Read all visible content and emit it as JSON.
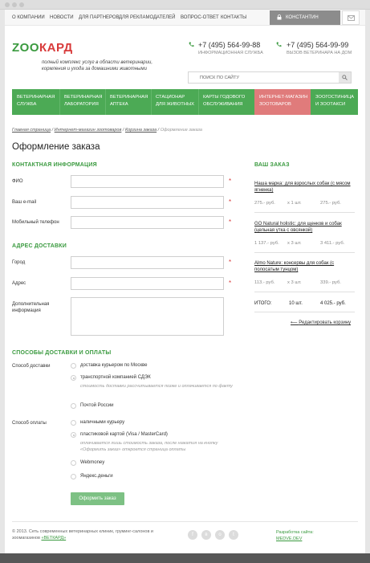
{
  "topnav": {
    "links": [
      "О КОМПАНИИ",
      "НОВОСТИ",
      "ДЛЯ ПАРТНЕРОВ",
      "ДЛЯ РЕКЛАМОДАТЕЛЕЙ",
      "ВОПРОС-ОТВЕТ",
      "КОНТАКТЫ"
    ],
    "user": "КОНСТАНТИН"
  },
  "header": {
    "logo_part1": "ZOO",
    "logo_part2": "КАРД",
    "tagline": "полный комплекс услуг в области ветеринарии, кормления и ухода за домашними животными",
    "phone1": "+7 (495) 564-99-88",
    "phone1_sub": "ИНФОРМАЦИОННАЯ СЛУЖБА",
    "phone2": "+7 (495) 564-99-99",
    "phone2_sub": "ВЫЗОВ ВЕТЕРИНАРА НА ДОМ",
    "search_placeholder": "ПОИСК ПО САЙТУ"
  },
  "menu": [
    {
      "l1": "ВЕТЕРИНАРНАЯ",
      "l2": "СЛУЖБА"
    },
    {
      "l1": "ВЕТЕРИНАРНАЯ",
      "l2": "ЛАБОРАТОРИЯ"
    },
    {
      "l1": "ВЕТЕРИНАРНАЯ",
      "l2": "АПТЕКА"
    },
    {
      "l1": "СТАЦИОНАР",
      "l2": "ДЛЯ ЖИВОТНЫХ"
    },
    {
      "l1": "КАРТЫ ГОДОВОГО",
      "l2": "ОБСЛУЖИВАНИЯ"
    },
    {
      "l1": "ИНТЕРНЕТ-МАГАЗИН",
      "l2": "ЗООТОВАРОВ"
    },
    {
      "l1": "ЗООГОСТИНИЦА",
      "l2": "И ЗООТАКСИ"
    }
  ],
  "breadcrumb": [
    "Главная страница",
    "Интернет-магазин зоотоваров",
    "Корзина заказа",
    "Оформление заказа"
  ],
  "page_title": "Оформление заказа",
  "contact": {
    "heading": "КОНТАКТНАЯ ИНФОРМАЦИЯ",
    "fio": "ФИО",
    "email": "Ваш e-mail",
    "phone": "Мобильный телефон",
    "required_mark": "*"
  },
  "address": {
    "heading": "АДРЕС ДОСТАВКИ",
    "city": "Город",
    "addr": "Адрес",
    "extra": "Дополнительная информация"
  },
  "order": {
    "heading": "ВАШ ЗАКАЗ",
    "items": [
      {
        "name": "Наша марка: для взрослых собак (с мясом ягненка)",
        "price": "275.- руб.",
        "qty": "х 1 шт.",
        "sum": "275.- руб."
      },
      {
        "name": "GO Natural holistic: для щенков и собак (цельная утка с овсянкой)",
        "price": "1 137.- руб.",
        "qty": "х 3 шт.",
        "sum": "3 411.- руб."
      },
      {
        "name": "Almo Nature: консервы для собак (с полосатым тунцом)",
        "price": "113.- руб.",
        "qty": "х 3 шт.",
        "sum": "339.- руб."
      }
    ],
    "total_label": "ИТОГО:",
    "total_qty": "10 шт.",
    "total_sum": "4 025.- руб.",
    "edit_link": "Редактировать корзину"
  },
  "delivery": {
    "heading": "СПОСОБЫ ДОСТАВКИ И ОПЛАТЫ",
    "label": "Способ доставки",
    "options": [
      "доставка курьером по Москве",
      "транспортной компанией СДЭК",
      "Почтой России"
    ],
    "note": "стоимость доставки рассчитывается позже и оплачивается по факту"
  },
  "payment": {
    "label": "Способ оплаты",
    "options": [
      "наличными курьеру",
      "пластиковой картой (Visa / MasterCard)",
      "Webmoney",
      "Яндекс.деньги"
    ],
    "note": "оплачивается лишь стоимость заказа, после нажатия на кнопку «Оформить заказ» откроется страница оплаты"
  },
  "submit_label": "Оформить заказ",
  "footer": {
    "text": "© 2013. Сеть современных ветеринарных клиник, груминг-салонов и зоомагазинов",
    "brand": "«ВЕТКАРД»",
    "dev_label": "Разработка сайта:",
    "dev_link": "MEDVE.DEV"
  }
}
